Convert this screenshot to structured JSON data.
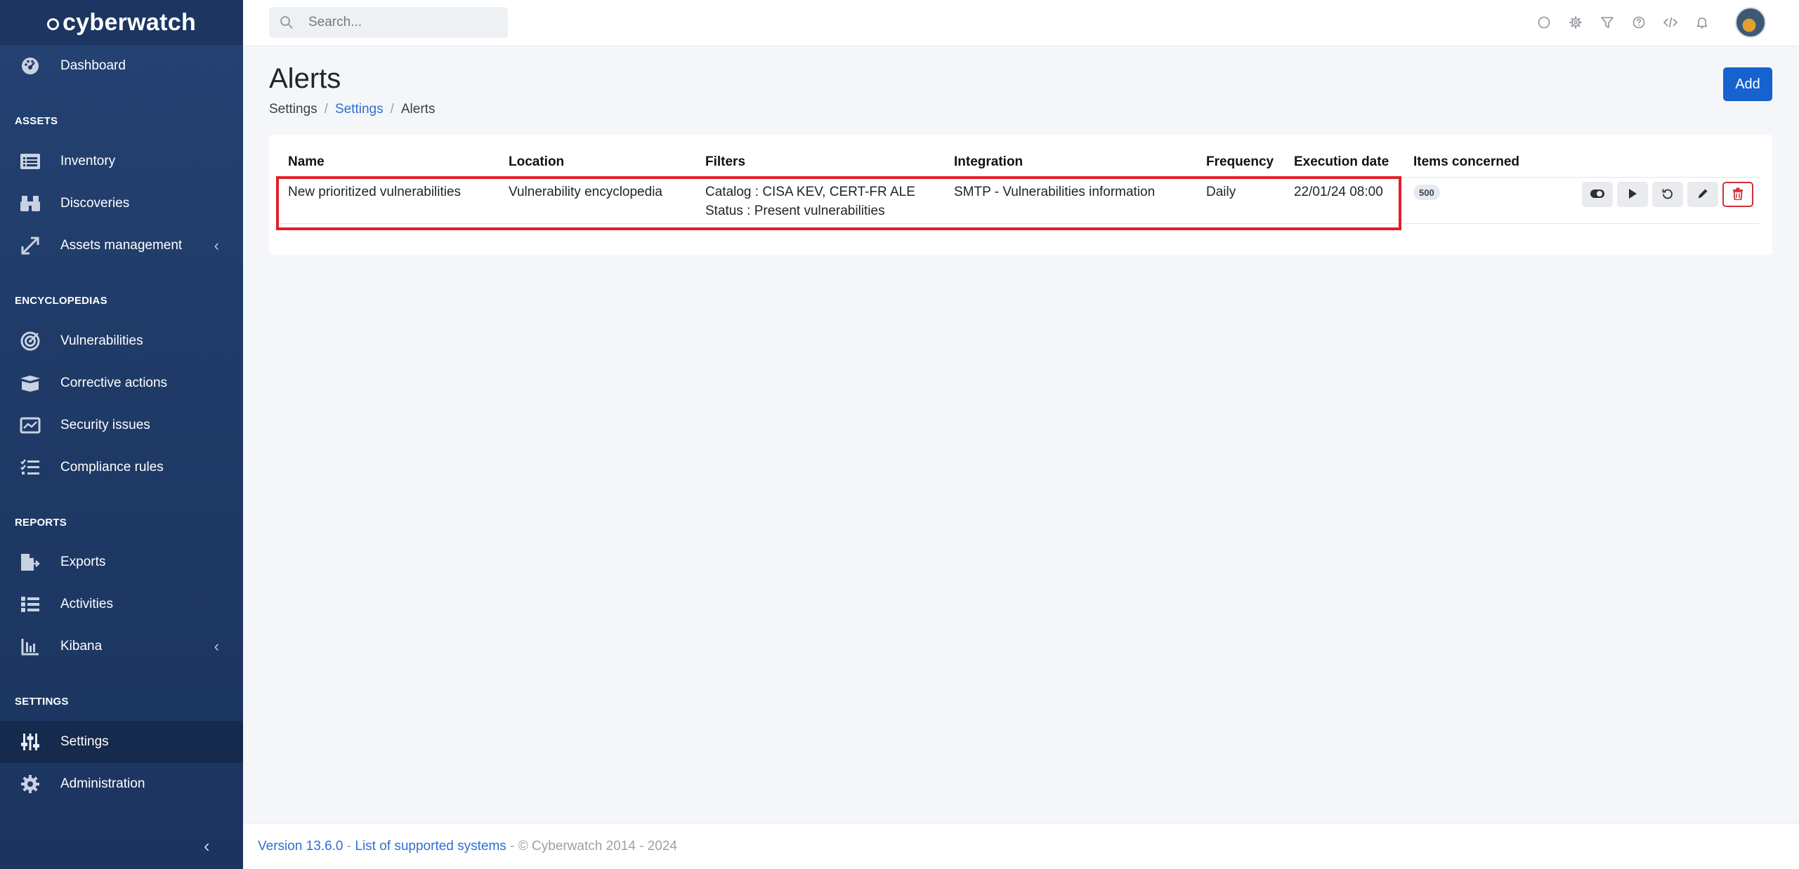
{
  "brand": {
    "name": "cyberwatch"
  },
  "sidebar": {
    "dashboard": "Dashboard",
    "sections": {
      "assets": "ASSETS",
      "encyclopedias": "ENCYCLOPEDIAS",
      "reports": "REPORTS",
      "settings": "SETTINGS"
    },
    "items": {
      "inventory": "Inventory",
      "discoveries": "Discoveries",
      "assets_management": "Assets management",
      "vulnerabilities": "Vulnerabilities",
      "corrective_actions": "Corrective actions",
      "security_issues": "Security issues",
      "compliance_rules": "Compliance rules",
      "exports": "Exports",
      "activities": "Activities",
      "kibana": "Kibana",
      "settings": "Settings",
      "administration": "Administration"
    },
    "active": "Settings"
  },
  "topbar": {
    "search_placeholder": "Search...",
    "icons": [
      "circle-icon",
      "gear-icon",
      "filter-icon",
      "help-icon",
      "code-icon",
      "bell-icon"
    ]
  },
  "page": {
    "title": "Alerts",
    "breadcrumb": [
      "Settings",
      "Settings",
      "Alerts"
    ],
    "add_button": "Add"
  },
  "table": {
    "headers": {
      "name": "Name",
      "location": "Location",
      "filters": "Filters",
      "integration": "Integration",
      "frequency": "Frequency",
      "execution_date": "Execution date",
      "items_concerned": "Items concerned"
    },
    "rows": [
      {
        "name": "New prioritized vulnerabilities",
        "location": "Vulnerability encyclopedia",
        "filter_catalog": "Catalog : CISA KEV, CERT-FR ALE",
        "filter_status": "Status : Present vulnerabilities",
        "integration": "SMTP - Vulnerabilities information",
        "frequency": "Daily",
        "execution_date": "22/01/24 08:00",
        "items_concerned": "500"
      }
    ]
  },
  "footer": {
    "version": "Version 13.6.0",
    "sep1": " - ",
    "supported": "List of supported systems",
    "copyright": " - © Cyberwatch 2014 - 2024"
  },
  "colors": {
    "sidebar": "#1f3a66",
    "accent": "#1662cf",
    "highlight": "#e0202a",
    "danger": "#d0303a"
  }
}
